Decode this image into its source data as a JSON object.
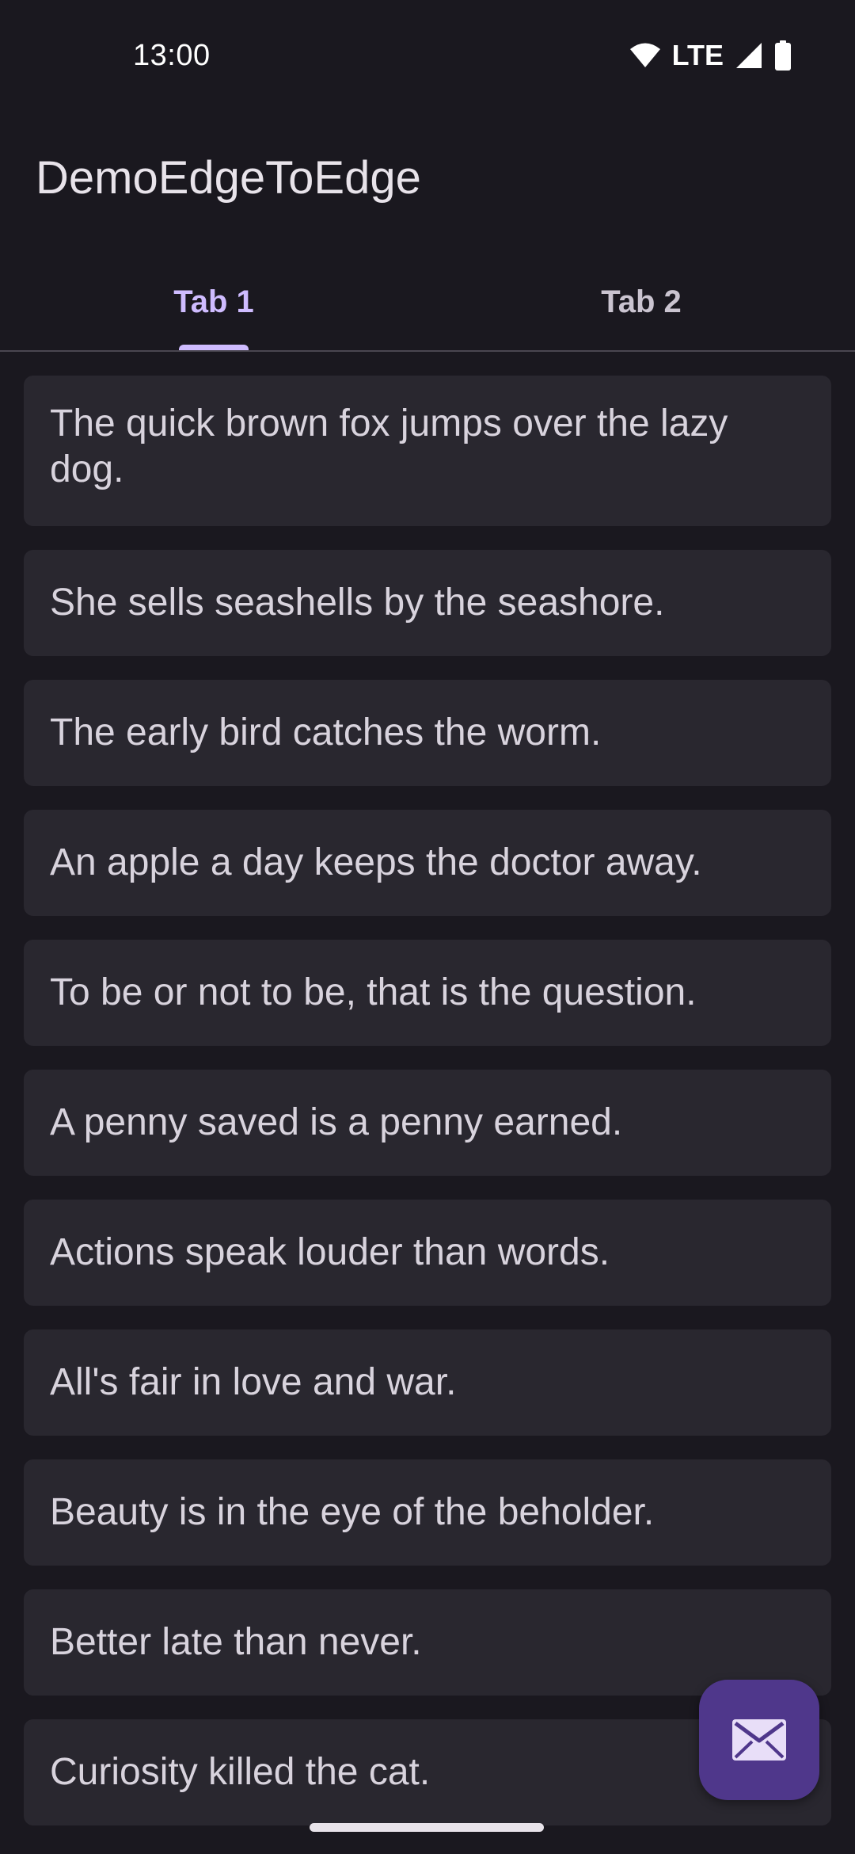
{
  "status_bar": {
    "time": "13:00",
    "network": "LTE",
    "icons": [
      "wifi-icon",
      "signal-icon",
      "battery-icon"
    ]
  },
  "app_bar": {
    "title": "DemoEdgeToEdge"
  },
  "tabs": [
    {
      "label": "Tab 1",
      "selected": true
    },
    {
      "label": "Tab 2",
      "selected": false
    }
  ],
  "items": [
    "The quick brown fox jumps over the lazy dog.",
    "She sells seashells by the seashore.",
    "The early bird catches the worm.",
    "An apple a day keeps the doctor away.",
    "To be or not to be, that is the question.",
    "A penny saved is a penny earned.",
    "Actions speak louder than words.",
    "All's fair in love and war.",
    "Beauty is in the eye of the beholder.",
    "Better late than never.",
    "Curiosity killed the cat."
  ],
  "fab": {
    "icon": "mail-icon"
  },
  "colors": {
    "background": "#1a181f",
    "card": "#29272f",
    "accent": "#cfbcff",
    "fab": "#4f378b"
  }
}
